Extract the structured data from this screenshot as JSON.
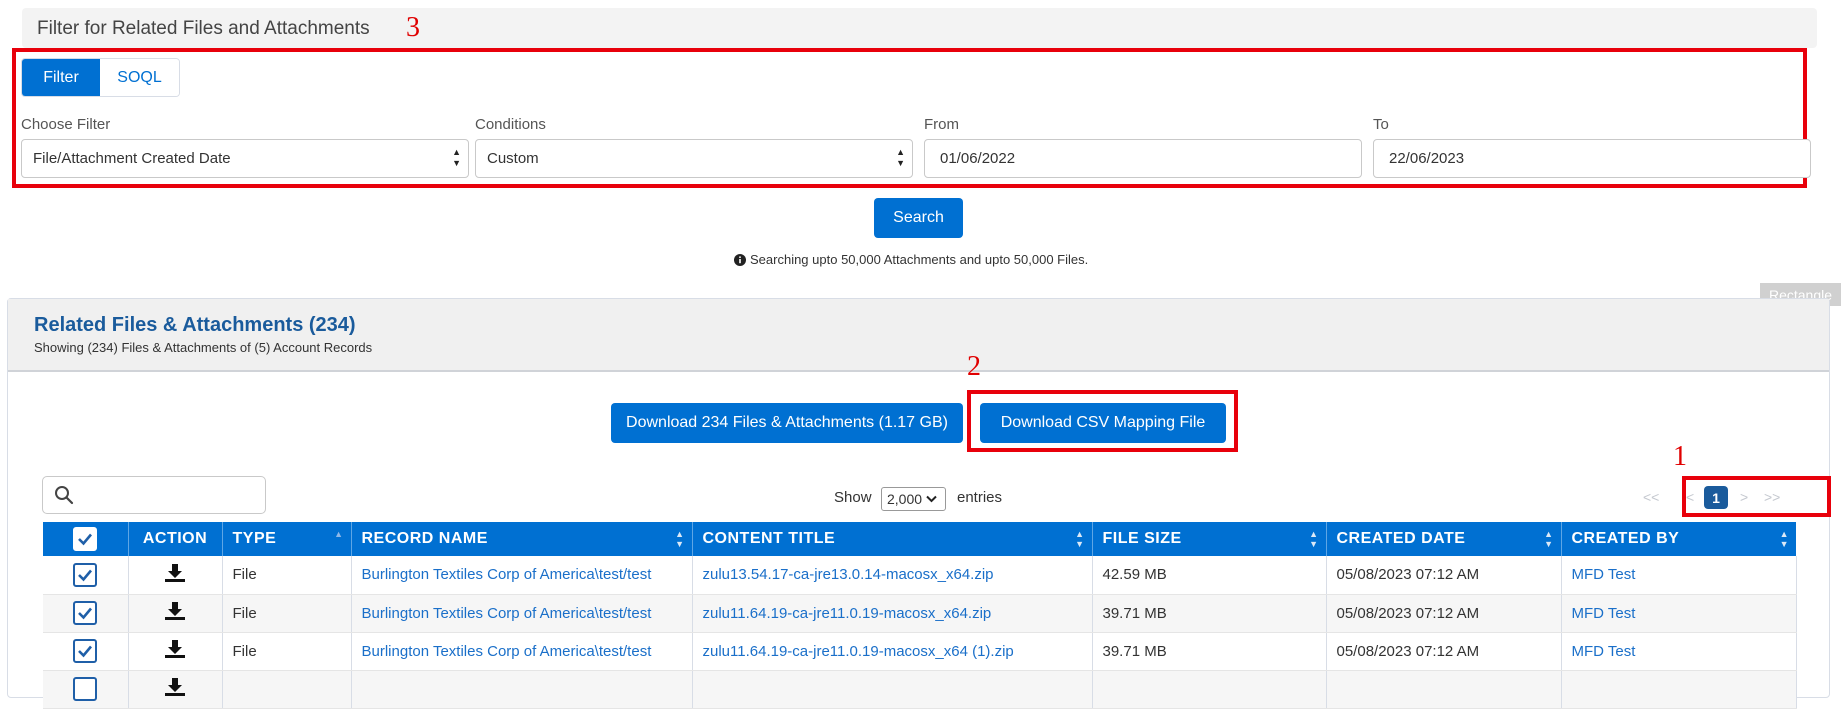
{
  "filter_section": {
    "title": "Filter for Related Files and Attachments",
    "tabs": [
      "Filter",
      "SOQL"
    ],
    "fields": {
      "choose_filter": {
        "label": "Choose Filter",
        "value": "File/Attachment Created Date"
      },
      "conditions": {
        "label": "Conditions",
        "value": "Custom"
      },
      "from": {
        "label": "From",
        "value": "01/06/2022"
      },
      "to": {
        "label": "To",
        "value": "22/06/2023"
      }
    },
    "search_button": "Search",
    "note": "Searching upto 50,000 Attachments and upto 50,000 Files."
  },
  "annotations": {
    "one": "1",
    "two": "2",
    "three": "3",
    "rectangle_tag": "Rectangle"
  },
  "results": {
    "title": "Related Files & Attachments (234)",
    "subtitle": "Showing (234) Files & Attachments of (5) Account Records",
    "download_all_button": "Download 234 Files & Attachments (1.17 GB)",
    "download_csv_button": "Download CSV Mapping File",
    "show_label": "Show",
    "entries_value": "2,000",
    "entries_label": "entries",
    "pager": {
      "first": "<<",
      "prev": "<",
      "current": "1",
      "next": ">",
      "last": ">>"
    },
    "columns": [
      "ACTION",
      "TYPE",
      "RECORD NAME",
      "CONTENT TITLE",
      "FILE SIZE",
      "CREATED DATE",
      "CREATED BY"
    ],
    "rows": [
      {
        "type": "File",
        "record_name": "Burlington Textiles Corp of America\\test/test",
        "content_title": "zulu13.54.17-ca-jre13.0.14-macosx_x64.zip",
        "file_size": "42.59 MB",
        "created_date": "05/08/2023 07:12 AM",
        "created_by": "MFD Test"
      },
      {
        "type": "File",
        "record_name": "Burlington Textiles Corp of America\\test/test",
        "content_title": "zulu11.64.19-ca-jre11.0.19-macosx_x64.zip",
        "file_size": "39.71 MB",
        "created_date": "05/08/2023 07:12 AM",
        "created_by": "MFD Test"
      },
      {
        "type": "File",
        "record_name": "Burlington Textiles Corp of America\\test/test",
        "content_title": "zulu11.64.19-ca-jre11.0.19-macosx_x64 (1).zip",
        "file_size": "39.71 MB",
        "created_date": "05/08/2023 07:12 AM",
        "created_by": "MFD Test"
      },
      {
        "type": "",
        "record_name": "",
        "content_title": "",
        "file_size": "",
        "created_date": "",
        "created_by": ""
      }
    ]
  },
  "colors": {
    "primary": "#0070d2",
    "link": "#1a6fc9",
    "annotation": "#e8000b"
  }
}
